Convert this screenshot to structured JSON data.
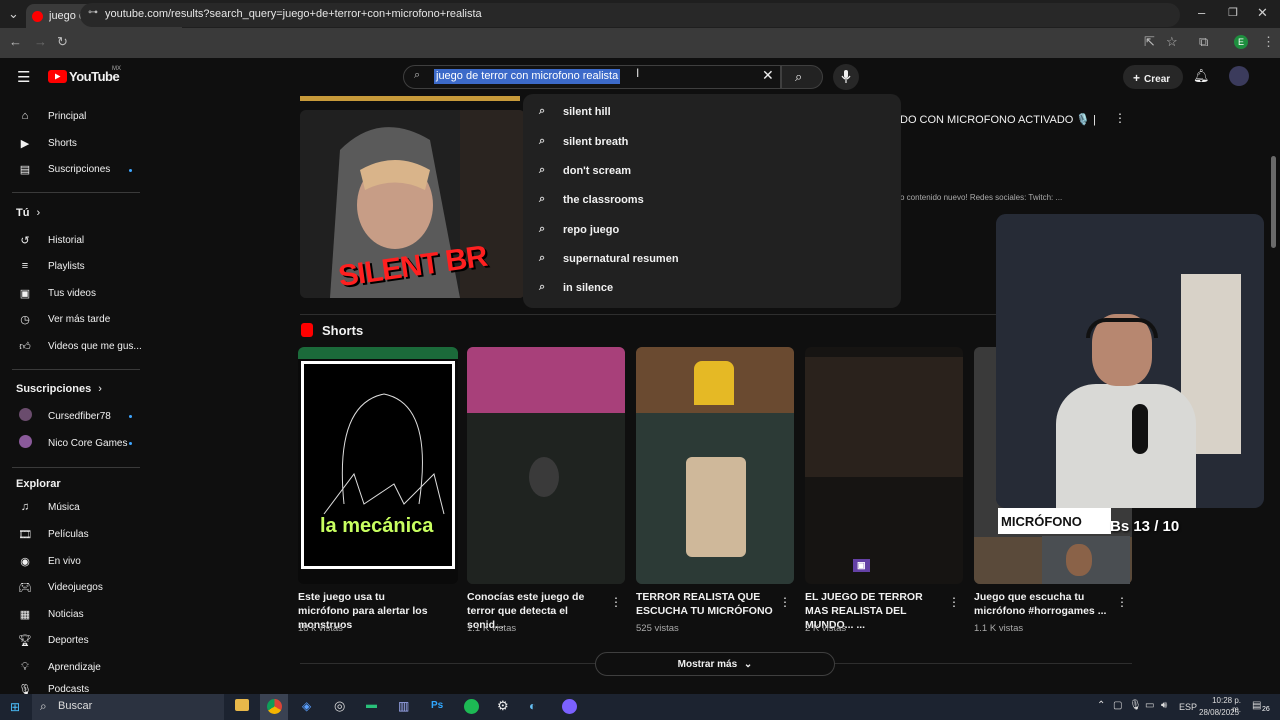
{
  "browser": {
    "tab_title": "juego de terror con micrófono",
    "tab_close": "✕",
    "new_tab": "+",
    "url": "youtube.com/results?search_query=juego+de+terror+con+microfono+realista",
    "profile_letter": "E"
  },
  "youtube": {
    "logo_text": "YouTube",
    "country_code": "MX",
    "search_value": "juego de terror con microfono realista",
    "create_label": "Crear"
  },
  "suggestions": [
    "silent hill",
    "silent breath",
    "don't scream",
    "the classrooms",
    "repo juego",
    "supernatural resumen",
    "in silence"
  ],
  "sidebar": {
    "main": [
      {
        "label": "Principal",
        "icon": "home-icon"
      },
      {
        "label": "Shorts",
        "icon": "shorts-icon"
      },
      {
        "label": "Suscripciones",
        "icon": "subscriptions-icon"
      }
    ],
    "you_heading": "Tú",
    "you": [
      {
        "label": "Historial",
        "icon": "history-icon"
      },
      {
        "label": "Playlists",
        "icon": "playlists-icon"
      },
      {
        "label": "Tus videos",
        "icon": "your-videos-icon"
      },
      {
        "label": "Ver más tarde",
        "icon": "watch-later-icon"
      },
      {
        "label": "Videos que me gus...",
        "icon": "liked-icon"
      }
    ],
    "subs_heading": "Suscripciones",
    "subs": [
      {
        "label": "Cursedfiber78"
      },
      {
        "label": "Nico Core Games"
      }
    ],
    "explore_heading": "Explorar",
    "explore": [
      {
        "label": "Música",
        "icon": "music-icon"
      },
      {
        "label": "Películas",
        "icon": "movies-icon"
      },
      {
        "label": "En vivo",
        "icon": "live-icon"
      },
      {
        "label": "Videojuegos",
        "icon": "gaming-icon"
      },
      {
        "label": "Noticias",
        "icon": "news-icon"
      },
      {
        "label": "Deportes",
        "icon": "sports-icon"
      },
      {
        "label": "Aprendizaje",
        "icon": "learning-icon"
      },
      {
        "label": "Podcasts",
        "icon": "podcasts-icon"
      }
    ]
  },
  "video": {
    "title_fragment": "DO CON MICROFONO ACTIVADO 🎙️ |",
    "desc_fragment": "o contenido nuevo! Redes sociales: Twitch: ...",
    "thumb_text": "SILENT BR"
  },
  "shorts": {
    "heading": "Shorts",
    "items": [
      {
        "title": "Este juego usa tu micrófono para alertar los monstruos",
        "views": "18 k vistas",
        "overlay": "la mecánica"
      },
      {
        "title": "Conocías este juego de terror que detecta el sonid...",
        "views": "1.1 K vistas"
      },
      {
        "title": "TERROR REALISTA QUE ESCUCHA TU MICRÓFONO",
        "views": "525 vistas"
      },
      {
        "title": "EL JUEGO DE TERROR MAS REALISTA DEL MUNDO... ...",
        "views": "2 K vistas"
      },
      {
        "title": "Juego que escucha tu micrófono #horrogames ...",
        "views": "1.1 K vistas"
      }
    ],
    "show_more": "Mostrar más"
  },
  "webcam": {
    "counter": "Bs 13 / 10",
    "banner": "MICRÓFONO"
  },
  "taskbar": {
    "search_label": "Buscar",
    "lang": "ESP",
    "time": "10:28 p. m.",
    "date": "28/08/2025",
    "notif_count": "26"
  },
  "colors": {
    "youtube_red": "#ff0000",
    "accent_blue": "#3ea6ff",
    "selection": "#3c6ac9"
  }
}
